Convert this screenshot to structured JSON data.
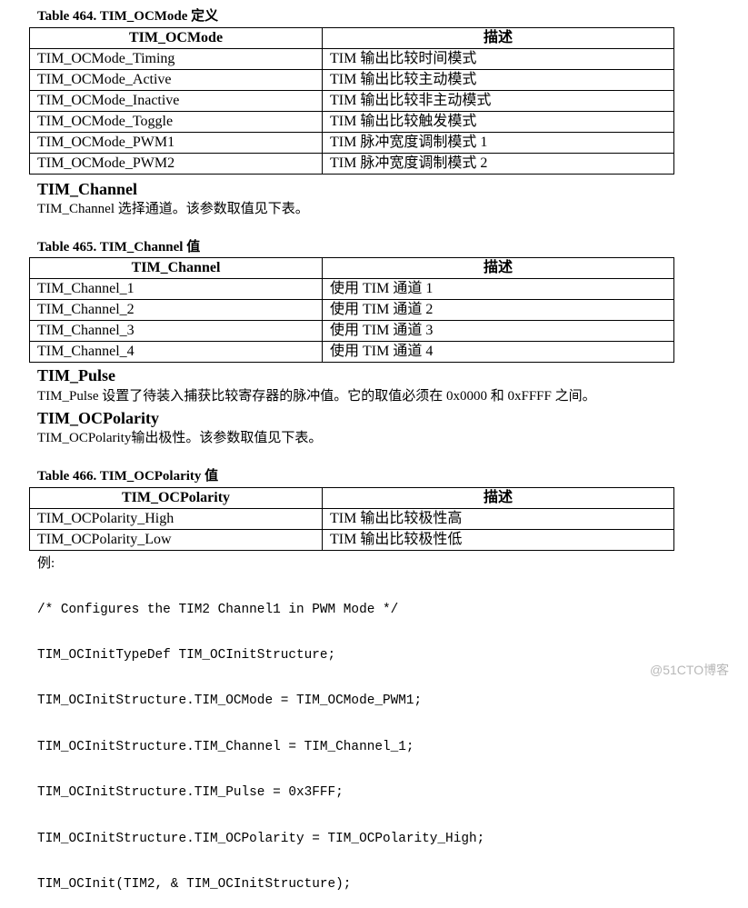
{
  "tables": [
    {
      "caption": "Table 464. TIM_OCMode 定义",
      "headers": [
        "TIM_OCMode",
        "描述"
      ],
      "rows": [
        [
          "TIM_OCMode_Timing",
          "TIM 输出比较时间模式"
        ],
        [
          "TIM_OCMode_Active",
          "TIM 输出比较主动模式"
        ],
        [
          "TIM_OCMode_Inactive",
          "TIM 输出比较非主动模式"
        ],
        [
          "TIM_OCMode_Toggle",
          "TIM 输出比较触发模式"
        ],
        [
          "TIM_OCMode_PWM1",
          "TIM 脉冲宽度调制模式 1"
        ],
        [
          "TIM_OCMode_PWM2",
          "TIM 脉冲宽度调制模式 2"
        ]
      ]
    },
    {
      "caption": "Table 465. TIM_Channel 值",
      "headers": [
        "TIM_Channel",
        "描述"
      ],
      "rows": [
        [
          "TIM_Channel_1",
          "使用 TIM 通道 1"
        ],
        [
          "TIM_Channel_2",
          "使用 TIM 通道 2"
        ],
        [
          "TIM_Channel_3",
          "使用 TIM 通道 3"
        ],
        [
          "TIM_Channel_4",
          "使用 TIM 通道 4"
        ]
      ]
    },
    {
      "caption": "Table 466. TIM_OCPolarity 值",
      "headers": [
        "TIM_OCPolarity",
        "描述"
      ],
      "rows": [
        [
          "TIM_OCPolarity_High",
          "TIM 输出比较极性高"
        ],
        [
          "TIM_OCPolarity_Low",
          "TIM 输出比较极性低"
        ]
      ]
    }
  ],
  "sections": {
    "channel": {
      "heading": "TIM_Channel",
      "text": "TIM_Channel 选择通道。该参数取值见下表。"
    },
    "pulse": {
      "heading": "TIM_Pulse",
      "text": "TIM_Pulse 设置了待装入捕获比较寄存器的脉冲值。它的取值必须在 0x0000 和 0xFFFF 之间。"
    },
    "polarity": {
      "heading": "TIM_OCPolarity",
      "text": "TIM_OCPolarity输出极性。该参数取值见下表。"
    }
  },
  "example": {
    "label": "例:",
    "code_lines": [
      "/* Configures the TIM2 Channel1 in PWM Mode */",
      "TIM_OCInitTypeDef TIM_OCInitStructure;",
      "TIM_OCInitStructure.TIM_OCMode = TIM_OCMode_PWM1;",
      "TIM_OCInitStructure.TIM_Channel = TIM_Channel_1;",
      "TIM_OCInitStructure.TIM_Pulse = 0x3FFF;",
      "TIM_OCInitStructure.TIM_OCPolarity = TIM_OCPolarity_High;",
      "TIM_OCInit(TIM2, & TIM_OCInitStructure);"
    ]
  },
  "watermark": "@51CTO博客"
}
